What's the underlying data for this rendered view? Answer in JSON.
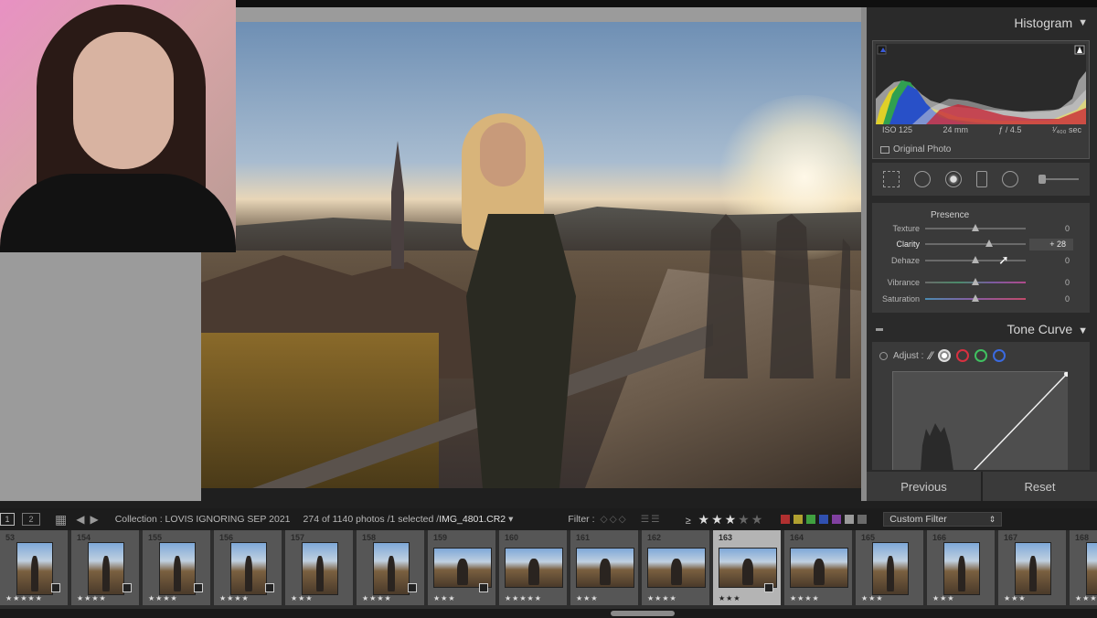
{
  "right_panel": {
    "histogram": {
      "title": "Histogram",
      "iso": "ISO 125",
      "focal": "24 mm",
      "aperture": "ƒ / 4.5",
      "shutter": "¹⁄₄₀₀ sec",
      "original_photo": "Original Photo"
    },
    "presence": {
      "title": "Presence",
      "sliders": [
        {
          "label": "Texture",
          "value": "0",
          "level": 0.5
        },
        {
          "label": "Clarity",
          "value": "+ 28",
          "level": 0.64
        },
        {
          "label": "Dehaze",
          "value": "0",
          "level": 0.5
        },
        {
          "label": "Vibrance",
          "value": "0",
          "level": 0.5
        },
        {
          "label": "Saturation",
          "value": "0",
          "level": 0.5
        }
      ]
    },
    "tone_curve": {
      "title": "Tone Curve",
      "adjust_label": "Adjust :"
    },
    "buttons": {
      "previous": "Previous",
      "reset": "Reset"
    }
  },
  "filmstrip_toolbar": {
    "monitor1": "1",
    "monitor2": "2",
    "collection": "Collection : LOVIS IGNORING SEP 2021",
    "count": "274 of 1140 photos /1 selected /",
    "filename": "IMG_4801.CR2",
    "filename_caret": "▾",
    "filter_label": "Filter :",
    "rating_op": "≥",
    "stars_on": "★★★",
    "stars_off": "★★",
    "custom_filter": "Custom Filter",
    "custom_filter_caret": "⇕",
    "label_colors": [
      "#b03030",
      "#b0a030",
      "#40a040",
      "#3050b0",
      "#8040a0",
      "#9a9a9a",
      "#6a6a6a"
    ]
  },
  "filmstrip": {
    "thumbs": [
      {
        "num": "53",
        "orient": "v",
        "stars": "★★★★★",
        "badge": true
      },
      {
        "num": "154",
        "orient": "v",
        "stars": "★★★★",
        "badge": true
      },
      {
        "num": "155",
        "orient": "v",
        "stars": "★★★★",
        "badge": true
      },
      {
        "num": "156",
        "orient": "v",
        "stars": "★★★★",
        "badge": true
      },
      {
        "num": "157",
        "orient": "v",
        "stars": "★★★",
        "badge": false
      },
      {
        "num": "158",
        "orient": "v",
        "stars": "★★★★",
        "badge": true
      },
      {
        "num": "159",
        "orient": "h",
        "stars": "★★★",
        "badge": true
      },
      {
        "num": "160",
        "orient": "h",
        "stars": "★★★★★",
        "badge": false
      },
      {
        "num": "161",
        "orient": "h",
        "stars": "★★★",
        "badge": false
      },
      {
        "num": "162",
        "orient": "h",
        "stars": "★★★★",
        "badge": false
      },
      {
        "num": "163",
        "orient": "h",
        "stars": "★★★",
        "badge": true,
        "selected": true
      },
      {
        "num": "164",
        "orient": "h",
        "stars": "★★★★",
        "badge": false
      },
      {
        "num": "165",
        "orient": "v",
        "stars": "★★★",
        "badge": false
      },
      {
        "num": "166",
        "orient": "v",
        "stars": "★★★",
        "badge": false
      },
      {
        "num": "167",
        "orient": "v",
        "stars": "★★★",
        "badge": false
      },
      {
        "num": "168",
        "orient": "v",
        "stars": "★★★",
        "badge": false
      }
    ]
  }
}
